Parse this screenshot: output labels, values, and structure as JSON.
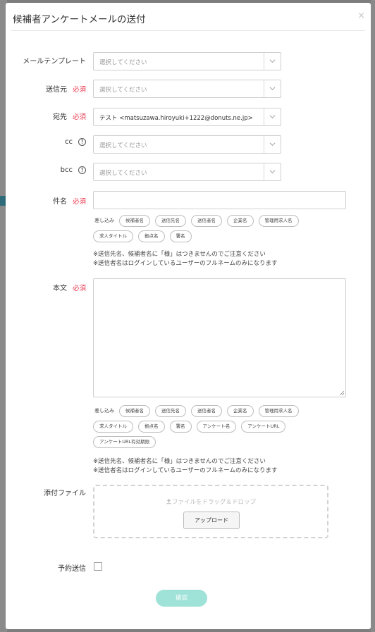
{
  "modal": {
    "title": "候補者アンケートメールの送付",
    "close": "×"
  },
  "form": {
    "template_label": "メールテンプレート",
    "template_placeholder": "選択してください",
    "from_label": "送信元",
    "from_placeholder": "選択してください",
    "to_label": "宛先",
    "to_value": "テスト <matsuzawa.hiroyuki+1222@donuts.ne.jp>",
    "cc_label": "cc",
    "cc_placeholder": "選択してください",
    "bcc_label": "bcc",
    "bcc_placeholder": "選択してください",
    "subject_label": "件名",
    "body_label": "本文",
    "attachment_label": "添付ファイル",
    "schedule_label": "予約送信",
    "required": "必須",
    "help": "?"
  },
  "insert": {
    "intro": "差し込み",
    "subject_tags": [
      "候補者名",
      "送信先名",
      "送信者名",
      "企業名",
      "管理用求人名",
      "求人タイトル",
      "拠点名",
      "署名"
    ],
    "body_tags": [
      "候補者名",
      "送信先名",
      "送信者名",
      "企業名",
      "管理用求人名",
      "求人タイトル",
      "拠点名",
      "署名",
      "アンケート名",
      "アンケートURL",
      "アンケートURL有効期限"
    ]
  },
  "notes": {
    "line1": "※送信先名、候補者名に「様」はつきませんのでご注意ください",
    "line2": "※送信者名はログインしているユーザーのフルネームのみになります"
  },
  "upload": {
    "drop_text": "ファイルをドラッグ＆ドロップ",
    "button": "アップロード"
  },
  "actions": {
    "confirm": "確認"
  },
  "colors": {
    "required": "#e8384f",
    "confirm_button": "#9fe2d8"
  }
}
